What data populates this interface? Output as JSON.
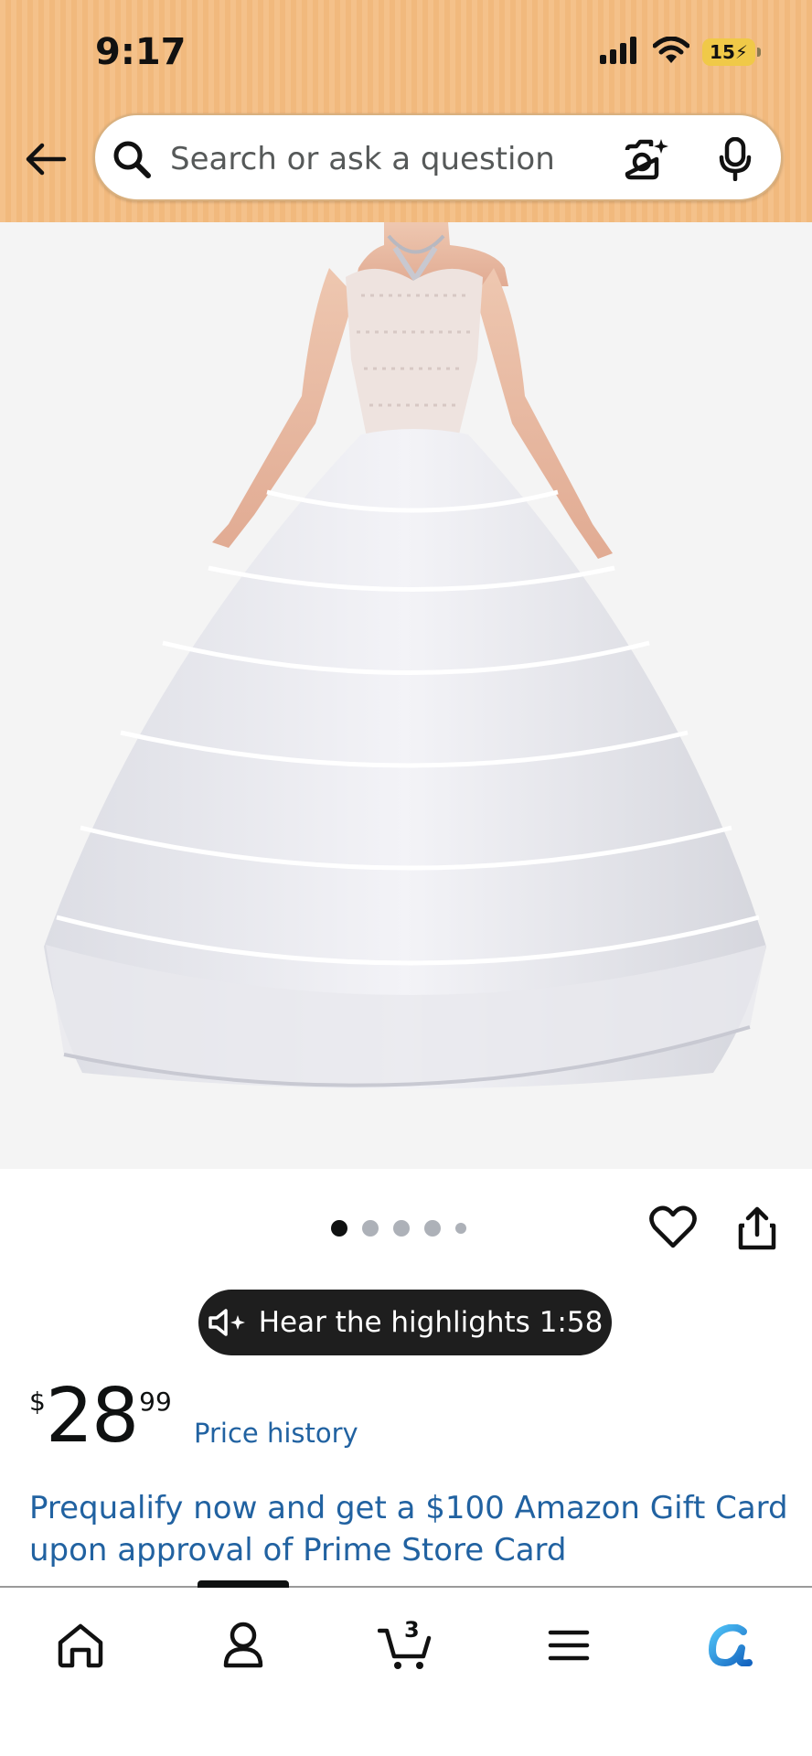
{
  "status_bar": {
    "time": "9:17",
    "battery": "15"
  },
  "search": {
    "placeholder": "Search or ask a question",
    "value": ""
  },
  "product": {
    "image_alt": "White hoop petticoat ball gown skirt",
    "image_count": 5,
    "active_image": 1
  },
  "audio": {
    "label": "Hear the highlights 1:58"
  },
  "price": {
    "currency": "$",
    "whole": "28",
    "fraction": "99"
  },
  "links": {
    "price_history": "Price history",
    "prequalify": "Prequalify now and get a $100 Amazon Gift Card upon approval of Prime Store Card"
  },
  "bottom_nav": {
    "cart_count": "3",
    "items": [
      "home",
      "account",
      "cart",
      "menu",
      "rufus"
    ]
  },
  "colors": {
    "header_bg": "#f4c18a",
    "link": "#2162a1",
    "pill_bg": "#1e1e1e",
    "rufus_blue": "#1e88e5"
  }
}
